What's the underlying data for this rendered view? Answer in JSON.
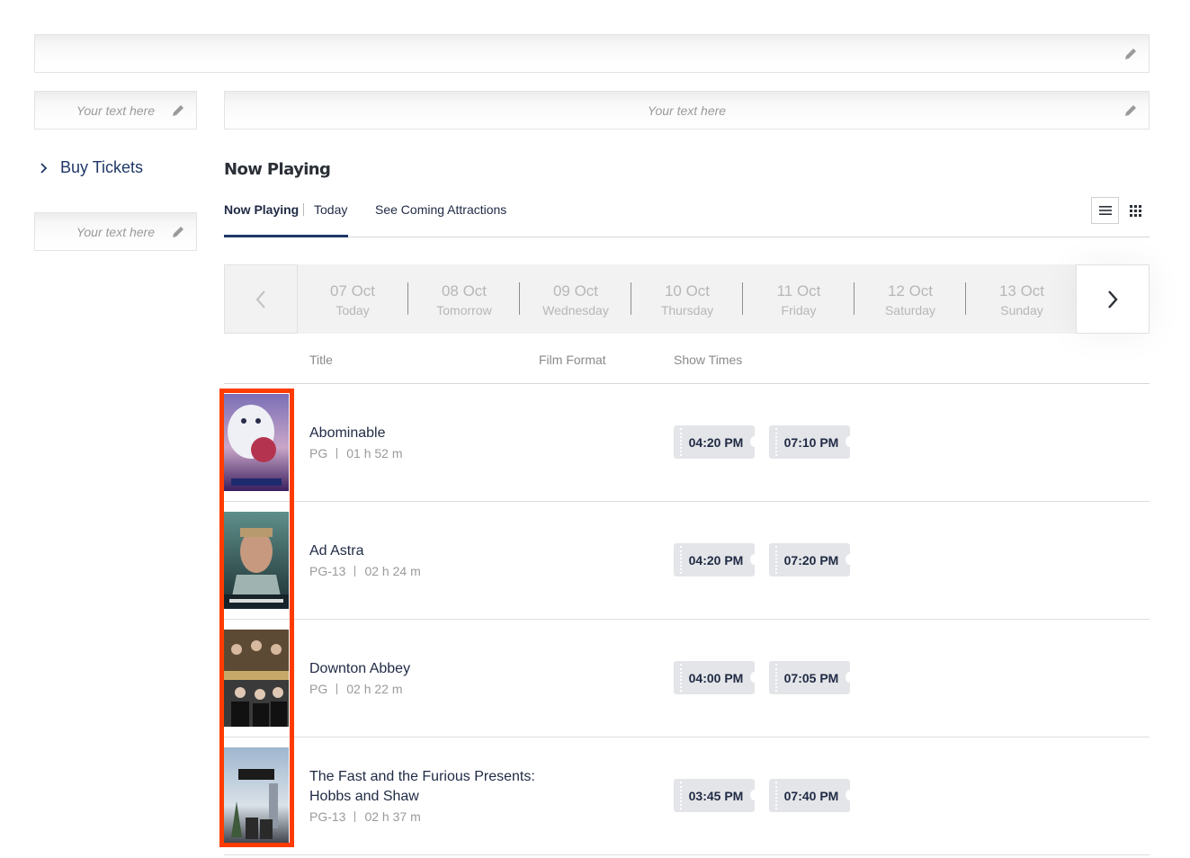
{
  "editable_placeholder": "Your text here",
  "sidebar": {
    "buy_tickets_label": "Buy Tickets"
  },
  "section": {
    "title": "Now Playing"
  },
  "tabs": {
    "now_playing": "Now Playing",
    "today": "Today",
    "coming": "See Coming Attractions"
  },
  "dates": [
    {
      "day": "07 Oct",
      "label": "Today"
    },
    {
      "day": "08 Oct",
      "label": "Tomorrow"
    },
    {
      "day": "09 Oct",
      "label": "Wednesday"
    },
    {
      "day": "10 Oct",
      "label": "Thursday"
    },
    {
      "day": "11 Oct",
      "label": "Friday"
    },
    {
      "day": "12 Oct",
      "label": "Saturday"
    },
    {
      "day": "13 Oct",
      "label": "Sunday"
    }
  ],
  "table": {
    "col_title": "Title",
    "col_format": "Film Format",
    "col_times": "Show Times"
  },
  "films": [
    {
      "title": "Abominable",
      "rating": "PG",
      "duration": "01 h 52 m",
      "times": [
        "04:20 PM",
        "07:10 PM"
      ]
    },
    {
      "title": "Ad Astra",
      "rating": "PG-13",
      "duration": "02 h 24 m",
      "times": [
        "04:20 PM",
        "07:20 PM"
      ]
    },
    {
      "title": "Downton Abbey",
      "rating": "PG",
      "duration": "02 h 22 m",
      "times": [
        "04:00 PM",
        "07:05 PM"
      ]
    },
    {
      "title_line1": "The Fast and the Furious Presents:",
      "title_line2": "Hobbs and Shaw",
      "rating": "PG-13",
      "duration": "02 h 37 m",
      "times": [
        "03:45 PM",
        "07:40 PM"
      ]
    }
  ],
  "colors": {
    "accent": "#1f3868",
    "highlight": "#ff3b00",
    "showtime_bg": "#e4e5e8"
  },
  "icons": [
    "pencil-icon",
    "chevron-right-icon",
    "list-view-icon",
    "grid-view-icon",
    "chevron-left-icon"
  ]
}
